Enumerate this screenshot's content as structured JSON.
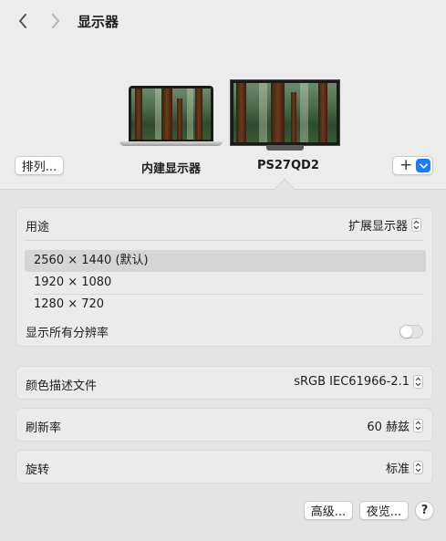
{
  "header": {
    "title": "显示器",
    "back_icon": "chevron-left-icon",
    "forward_icon": "chevron-right-icon"
  },
  "arrangement": {
    "arrange_button": "排列...",
    "builtin_display_label": "内建显示器",
    "external_display_label": "PS27QD2",
    "add_button": "+",
    "add_menu_icon": "chevron-down-icon",
    "accent_color": "#1b7cf6"
  },
  "usage": {
    "label": "用途",
    "value": "扩展显示器"
  },
  "resolutions": {
    "items": [
      "2560 × 1440 (默认)",
      "1920 × 1080",
      "1280 × 720"
    ],
    "selected_index": 0,
    "show_all_label": "显示所有分辨率",
    "show_all_enabled": false
  },
  "color_profile": {
    "label": "颜色描述文件",
    "value": "sRGB IEC61966-2.1"
  },
  "refresh_rate": {
    "label": "刷新率",
    "value": "60 赫兹"
  },
  "rotation": {
    "label": "旋转",
    "value": "标准"
  },
  "footer": {
    "advanced_button": "高级...",
    "night_shift_button": "夜览...",
    "help_button": "?"
  }
}
